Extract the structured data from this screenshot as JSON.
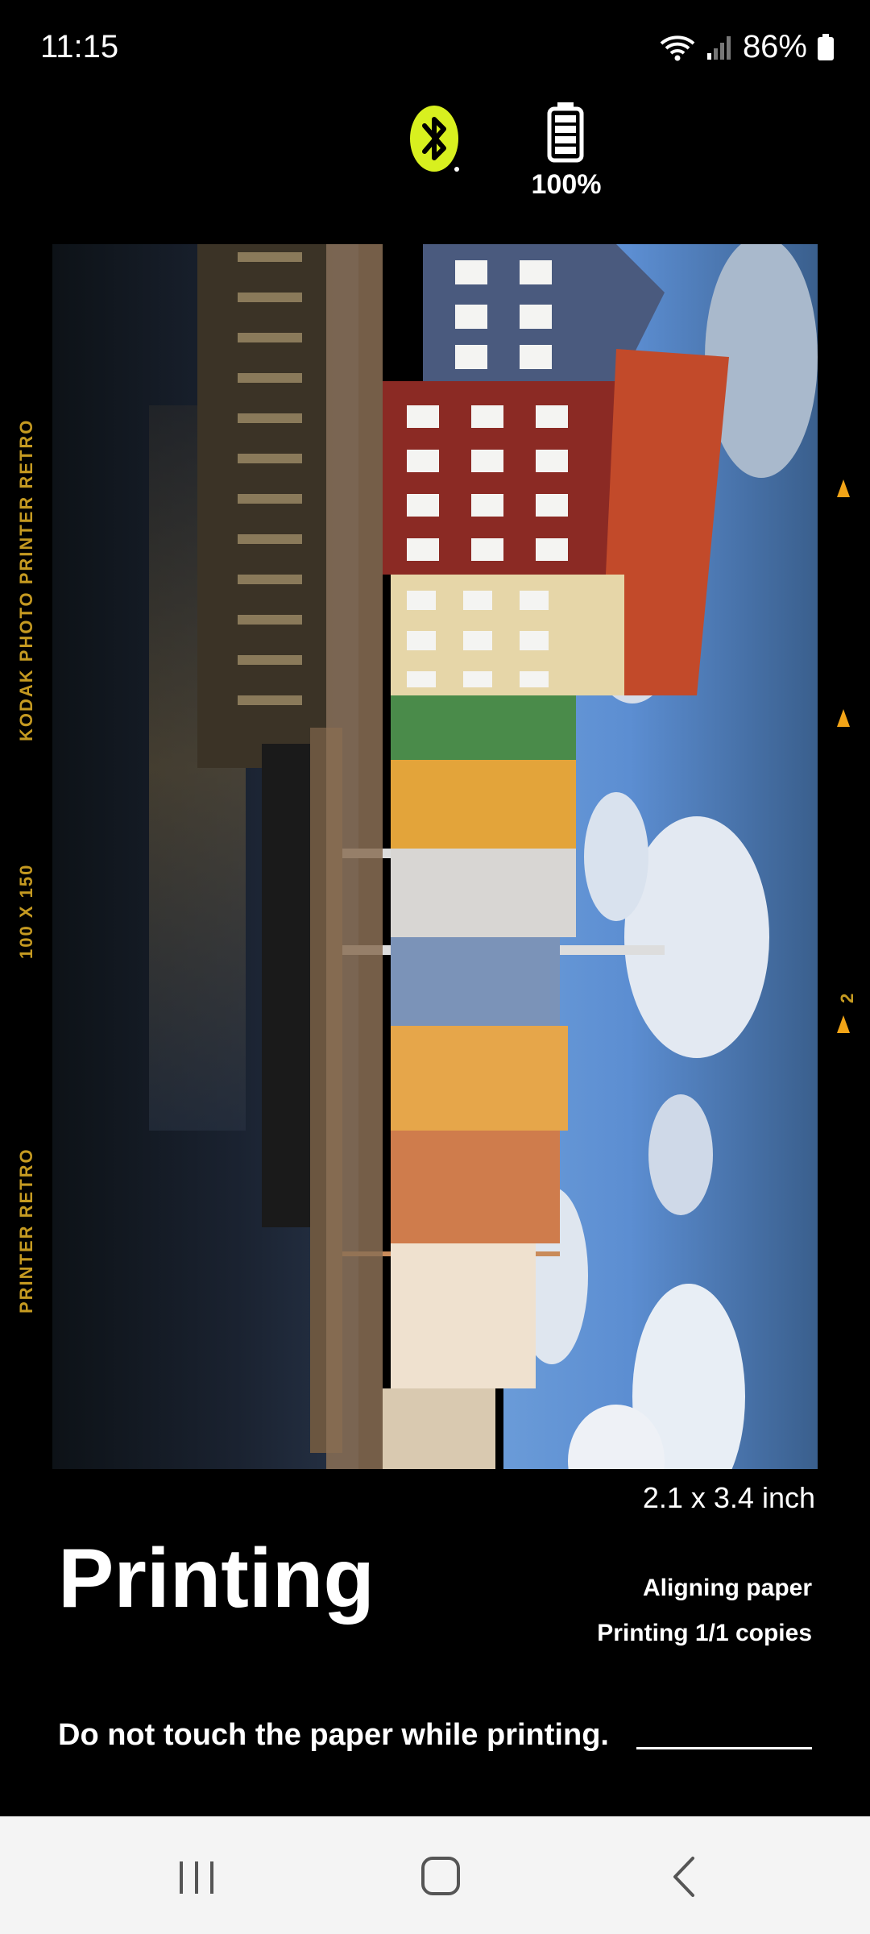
{
  "status_bar": {
    "time": "11:15",
    "battery": "86%"
  },
  "device": {
    "bluetooth_icon": "bluetooth-icon",
    "battery_icon": "battery-full-icon",
    "battery_level": "100%",
    "accent": "#d8f01f"
  },
  "film": {
    "left_top": "KODAK PHOTO PRINTER RETRO",
    "left_mid": "100 X 150",
    "left_bottom": "PRINTER RETRO",
    "right_number": "2",
    "accent": "#c59a21"
  },
  "print": {
    "size": "2.1 x 3.4 inch",
    "title": "Printing",
    "step": "Aligning paper",
    "copies": "Printing 1/1 copies",
    "notice": "Do not touch the paper while printing."
  },
  "nav": {
    "recents_icon": "recents-icon",
    "home_icon": "home-icon",
    "back_icon": "back-icon"
  }
}
